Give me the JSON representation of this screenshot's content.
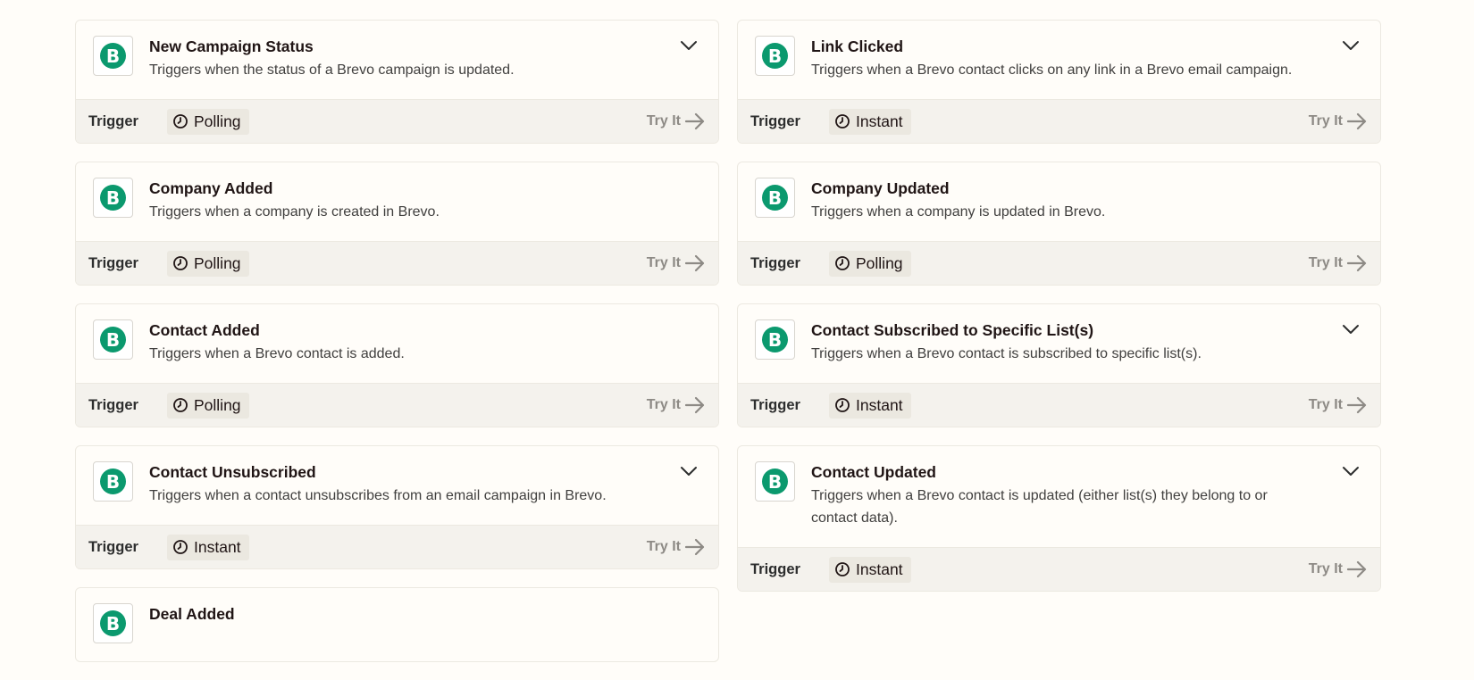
{
  "logo_letter": "B",
  "brand_color": "#0b996e",
  "trigger_label": "Trigger",
  "try_label": "Try It",
  "left_cards": [
    {
      "title": "New Campaign Status",
      "desc": "Triggers when the status of a Brevo campaign is updated.",
      "badge": "Polling",
      "chevron": true
    },
    {
      "title": "Company Added",
      "desc": "Triggers when a company is created in Brevo.",
      "badge": "Polling",
      "chevron": false
    },
    {
      "title": "Contact Added",
      "desc": "Triggers when a Brevo contact is added.",
      "badge": "Polling",
      "chevron": false
    },
    {
      "title": "Contact Unsubscribed",
      "desc": "Triggers when a contact unsubscribes from an email campaign in Brevo.",
      "badge": "Instant",
      "chevron": true
    },
    {
      "title": "Deal Added",
      "desc": "",
      "badge": "",
      "chevron": false
    }
  ],
  "right_cards": [
    {
      "title": "Link Clicked",
      "desc": "Triggers when a Brevo contact clicks on any link in a Brevo email campaign.",
      "badge": "Instant",
      "chevron": true
    },
    {
      "title": "Company Updated",
      "desc": "Triggers when a company is updated in Brevo.",
      "badge": "Polling",
      "chevron": false
    },
    {
      "title": "Contact Subscribed to Specific List(s)",
      "desc": "Triggers when a Brevo contact is subscribed to specific list(s).",
      "badge": "Instant",
      "chevron": true
    },
    {
      "title": "Contact Updated",
      "desc": "Triggers when a Brevo contact is updated (either list(s) they belong to or contact data).",
      "badge": "Instant",
      "chevron": true
    }
  ]
}
